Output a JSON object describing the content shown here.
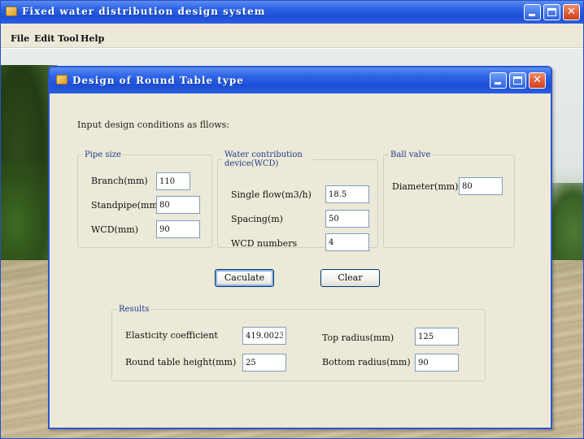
{
  "main_window": {
    "title": "Fixed water distribution design system",
    "menu": [
      "File",
      "Edit",
      "Tool",
      "Help"
    ]
  },
  "dialog": {
    "title": "Design of Round Table type",
    "instruction": "Input design conditions as fllows:",
    "pipe_size": {
      "legend": "Pipe size",
      "branch": {
        "label": "Branch(mm)",
        "value": "110"
      },
      "standpipe": {
        "label": "Standpipe(mm)",
        "value": "80"
      },
      "wcd": {
        "label": "WCD(mm)",
        "value": "90"
      }
    },
    "water_device": {
      "legend": "Water contribution device(WCD)",
      "single_flow": {
        "label": "Single flow(m3/h)",
        "value": "18.5"
      },
      "spacing": {
        "label": "Spacing(m)",
        "value": "50"
      },
      "wcd_numbers": {
        "label": "WCD numbers",
        "value": "4"
      }
    },
    "ball_valve": {
      "legend": "Ball valve",
      "diameter": {
        "label": "Diameter(mm)",
        "value": "80"
      }
    },
    "buttons": {
      "calculate": "Caculate",
      "clear": "Clear"
    },
    "results": {
      "legend": "Results",
      "elasticity": {
        "label": "Elasticity coefficient",
        "value": "419.0023"
      },
      "table_height": {
        "label": "Round table height(mm)",
        "value": "25"
      },
      "top_radius": {
        "label": "Top radius(mm)",
        "value": "125"
      },
      "bottom_radius": {
        "label": "Bottom radius(mm)",
        "value": "90"
      }
    }
  },
  "colors": {
    "titlebar": "#2c63e6",
    "dialog_bg": "#ece9d8",
    "group_legend": "#1d3b8a",
    "close_button": "#cf3f1c"
  }
}
